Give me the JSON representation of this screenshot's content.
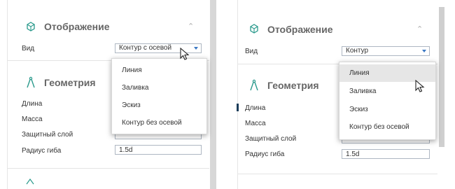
{
  "left": {
    "display_title": "Отображение",
    "view_label": "Вид",
    "view_value": "Контур с осевой",
    "geometry_title": "Геометрия",
    "fields": [
      {
        "label": "Длина",
        "value": ""
      },
      {
        "label": "Масса",
        "value": ""
      },
      {
        "label": "Защитный слой",
        "value": ""
      },
      {
        "label": "Радиус гиба",
        "value": "1.5d"
      }
    ],
    "dropdown": [
      "Линия",
      "Заливка",
      "Эскиз",
      "Контур без осевой"
    ]
  },
  "right": {
    "display_title": "Отображение",
    "view_label": "Вид",
    "view_value": "Контур",
    "geometry_title": "Геометрия",
    "fields": [
      {
        "label": "Длина",
        "value": ""
      },
      {
        "label": "Масса",
        "value": ""
      },
      {
        "label": "Защитный слой",
        "value": ""
      },
      {
        "label": "Радиус гиба",
        "value": "1.5d"
      }
    ],
    "dropdown": [
      "Линия",
      "Заливка",
      "Эскиз",
      "Контур без осевой"
    ],
    "hovered_option": "Линия"
  },
  "icons": {
    "display": "cube-outline-icon",
    "geometry": "compass-icon",
    "collapse": "chevron-up-icon",
    "cursor": "mouse-pointer-icon"
  },
  "colors": {
    "accent": "#3b78c4",
    "icon": "#2a9a8c"
  }
}
